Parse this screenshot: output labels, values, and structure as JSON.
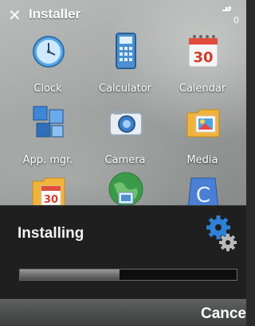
{
  "title_bar": {
    "title": "Installer",
    "close_icon": "close-icon",
    "signal_icon": "signal-strength-icon",
    "signal_digit": "0"
  },
  "grid": {
    "items": [
      {
        "label": "Clock",
        "icon": "clock-icon"
      },
      {
        "label": "Calculator",
        "icon": "calculator-icon"
      },
      {
        "label": "Calendar",
        "icon": "calendar-icon"
      },
      {
        "label": "App. mgr.",
        "icon": "app-manager-icon"
      },
      {
        "label": "Camera",
        "icon": "camera-icon"
      },
      {
        "label": "Media",
        "icon": "media-folder-icon"
      },
      {
        "label": "",
        "icon": "calendar-folder-icon"
      },
      {
        "label": "",
        "icon": "globe-icon"
      },
      {
        "label": "",
        "icon": "c-app-icon"
      }
    ],
    "calendar_day": "30"
  },
  "dialog": {
    "title": "Installing",
    "icon": "gears-icon",
    "progress_fraction": 0.46
  },
  "softkeys": {
    "right_label": "Cance"
  }
}
